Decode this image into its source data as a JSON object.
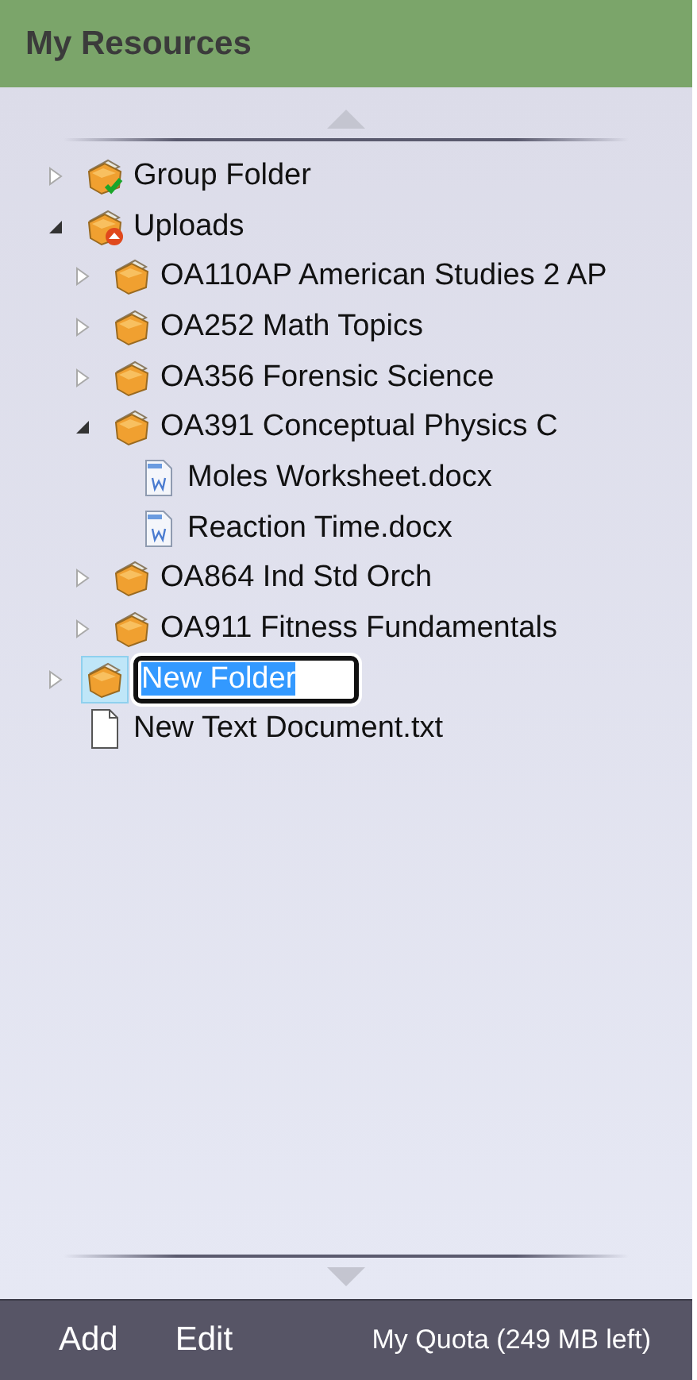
{
  "header": {
    "title": "My Resources"
  },
  "tree": [
    {
      "kind": "group-folder",
      "label": "Group Folder",
      "expanded": false,
      "editing": false
    },
    {
      "kind": "upload-folder",
      "label": "Uploads",
      "expanded": true,
      "editing": false,
      "children": [
        {
          "kind": "folder",
          "label": "OA110AP American Studies 2 AP",
          "expanded": false,
          "editing": false
        },
        {
          "kind": "folder",
          "label": "OA252 Math Topics",
          "expanded": false,
          "editing": false
        },
        {
          "kind": "folder",
          "label": "OA356 Forensic Science",
          "expanded": false,
          "editing": false
        },
        {
          "kind": "folder",
          "label": "OA391 Conceptual Physics C",
          "expanded": true,
          "editing": false,
          "children": [
            {
              "kind": "doc",
              "label": "Moles Worksheet.docx"
            },
            {
              "kind": "doc",
              "label": "Reaction Time.docx"
            }
          ]
        },
        {
          "kind": "folder",
          "label": "OA864 Ind Std Orch",
          "expanded": false,
          "editing": false
        },
        {
          "kind": "folder",
          "label": "OA911 Fitness Fundamentals",
          "expanded": false,
          "editing": false
        }
      ]
    },
    {
      "kind": "folder",
      "label": "New Folder",
      "expanded": false,
      "editing": true
    },
    {
      "kind": "text",
      "label": "New Text Document.txt"
    }
  ],
  "footer": {
    "buttons": [
      "Add",
      "Edit"
    ],
    "quota": "My Quota (249 MB left)"
  }
}
